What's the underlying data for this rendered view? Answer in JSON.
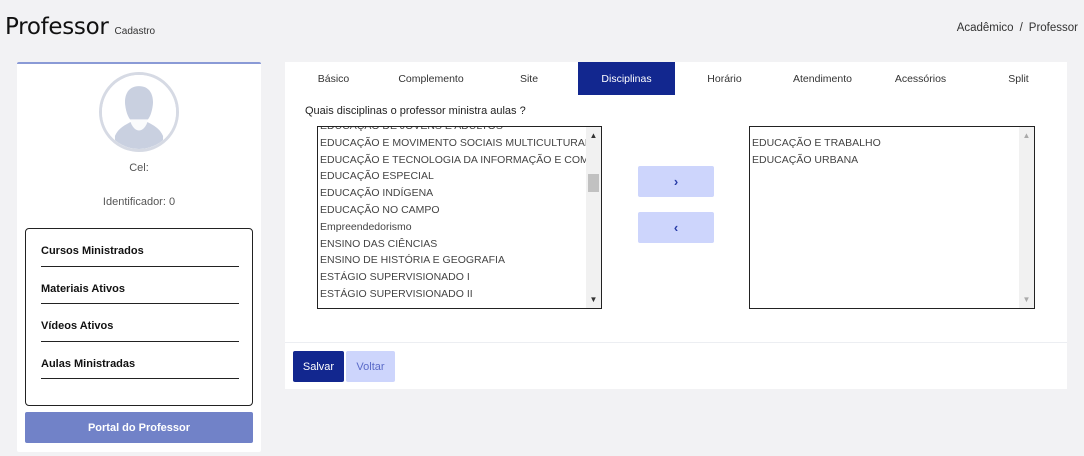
{
  "header": {
    "title": "Professor",
    "subtitle": "Cadastro"
  },
  "breadcrumb": {
    "items": [
      "Acadêmico",
      "/",
      "Professor"
    ]
  },
  "profile": {
    "cel_label": "Cel:",
    "identificador_label": "Identificador: 0",
    "stats": [
      {
        "label": "Cursos Ministrados"
      },
      {
        "label": "Materiais Ativos"
      },
      {
        "label": "Vídeos Ativos"
      },
      {
        "label": "Aulas Ministradas"
      }
    ],
    "portal_button": "Portal do Professor"
  },
  "tabs": [
    {
      "label": "Básico",
      "active": false
    },
    {
      "label": "Complemento",
      "active": false
    },
    {
      "label": "Site",
      "active": false
    },
    {
      "label": "Disciplinas",
      "active": true
    },
    {
      "label": "Horário",
      "active": false
    },
    {
      "label": "Atendimento",
      "active": false
    },
    {
      "label": "Acessórios",
      "active": false
    },
    {
      "label": "Split",
      "active": false
    }
  ],
  "disciplinas": {
    "question": "Quais disciplinas o professor ministra aulas ?",
    "available": [
      "EDUCAÇÃO DE JOVENS E ADULTOS",
      "EDUCAÇÃO E MOVIMENTO SOCIAIS MULTICULTURALISMO",
      "EDUCAÇÃO E TECNOLOGIA DA INFORMAÇÃO E COMUNICAÇÃO",
      "EDUCAÇÃO ESPECIAL",
      "EDUCAÇÃO INDÍGENA",
      "EDUCAÇÃO NO CAMPO",
      "Empreendedorismo",
      "ENSINO DAS CIÊNCIAS",
      "ENSINO DE HISTÓRIA E GEOGRAFIA",
      "ESTÁGIO SUPERVISIONADO I",
      "ESTÁGIO SUPERVISIONADO II"
    ],
    "selected": [
      "EDUCAÇÃO E TRABALHO",
      "EDUCAÇÃO URBANA"
    ],
    "add_button": "›",
    "remove_button": "‹"
  },
  "actions": {
    "save": "Salvar",
    "back": "Voltar"
  },
  "colors": {
    "primary": "#12278f",
    "light_accent": "#cdd5fc",
    "portal_button": "#7182c8",
    "background": "#f2f2f4"
  }
}
